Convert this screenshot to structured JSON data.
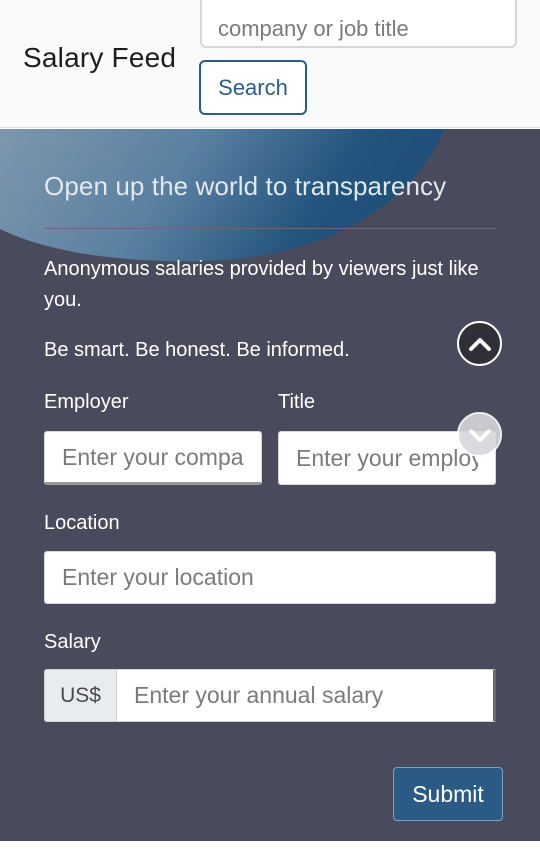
{
  "header": {
    "title": "Salary Feed",
    "search_placeholder": "company or job title",
    "search_button": "Search"
  },
  "panel": {
    "heading": "Open up the world to transparency",
    "description": "Anonymous salaries provided by viewers just like you.",
    "tagline": "Be smart. Be honest. Be informed."
  },
  "form": {
    "employer_label": "Employer",
    "employer_placeholder": "Enter your company",
    "title_label": "Title",
    "title_placeholder": "Enter your employer title",
    "location_label": "Location",
    "location_placeholder": "Enter your location",
    "salary_label": "Salary",
    "salary_prefix": "US$",
    "salary_placeholder": "Enter your annual salary",
    "submit_label": "Submit"
  },
  "icons": {
    "scroll_up": "chevron-up-icon",
    "scroll_down": "chevron-down-icon"
  },
  "colors": {
    "panel_bg": "#4a4a5d",
    "accent_blue": "#2b5a84"
  }
}
